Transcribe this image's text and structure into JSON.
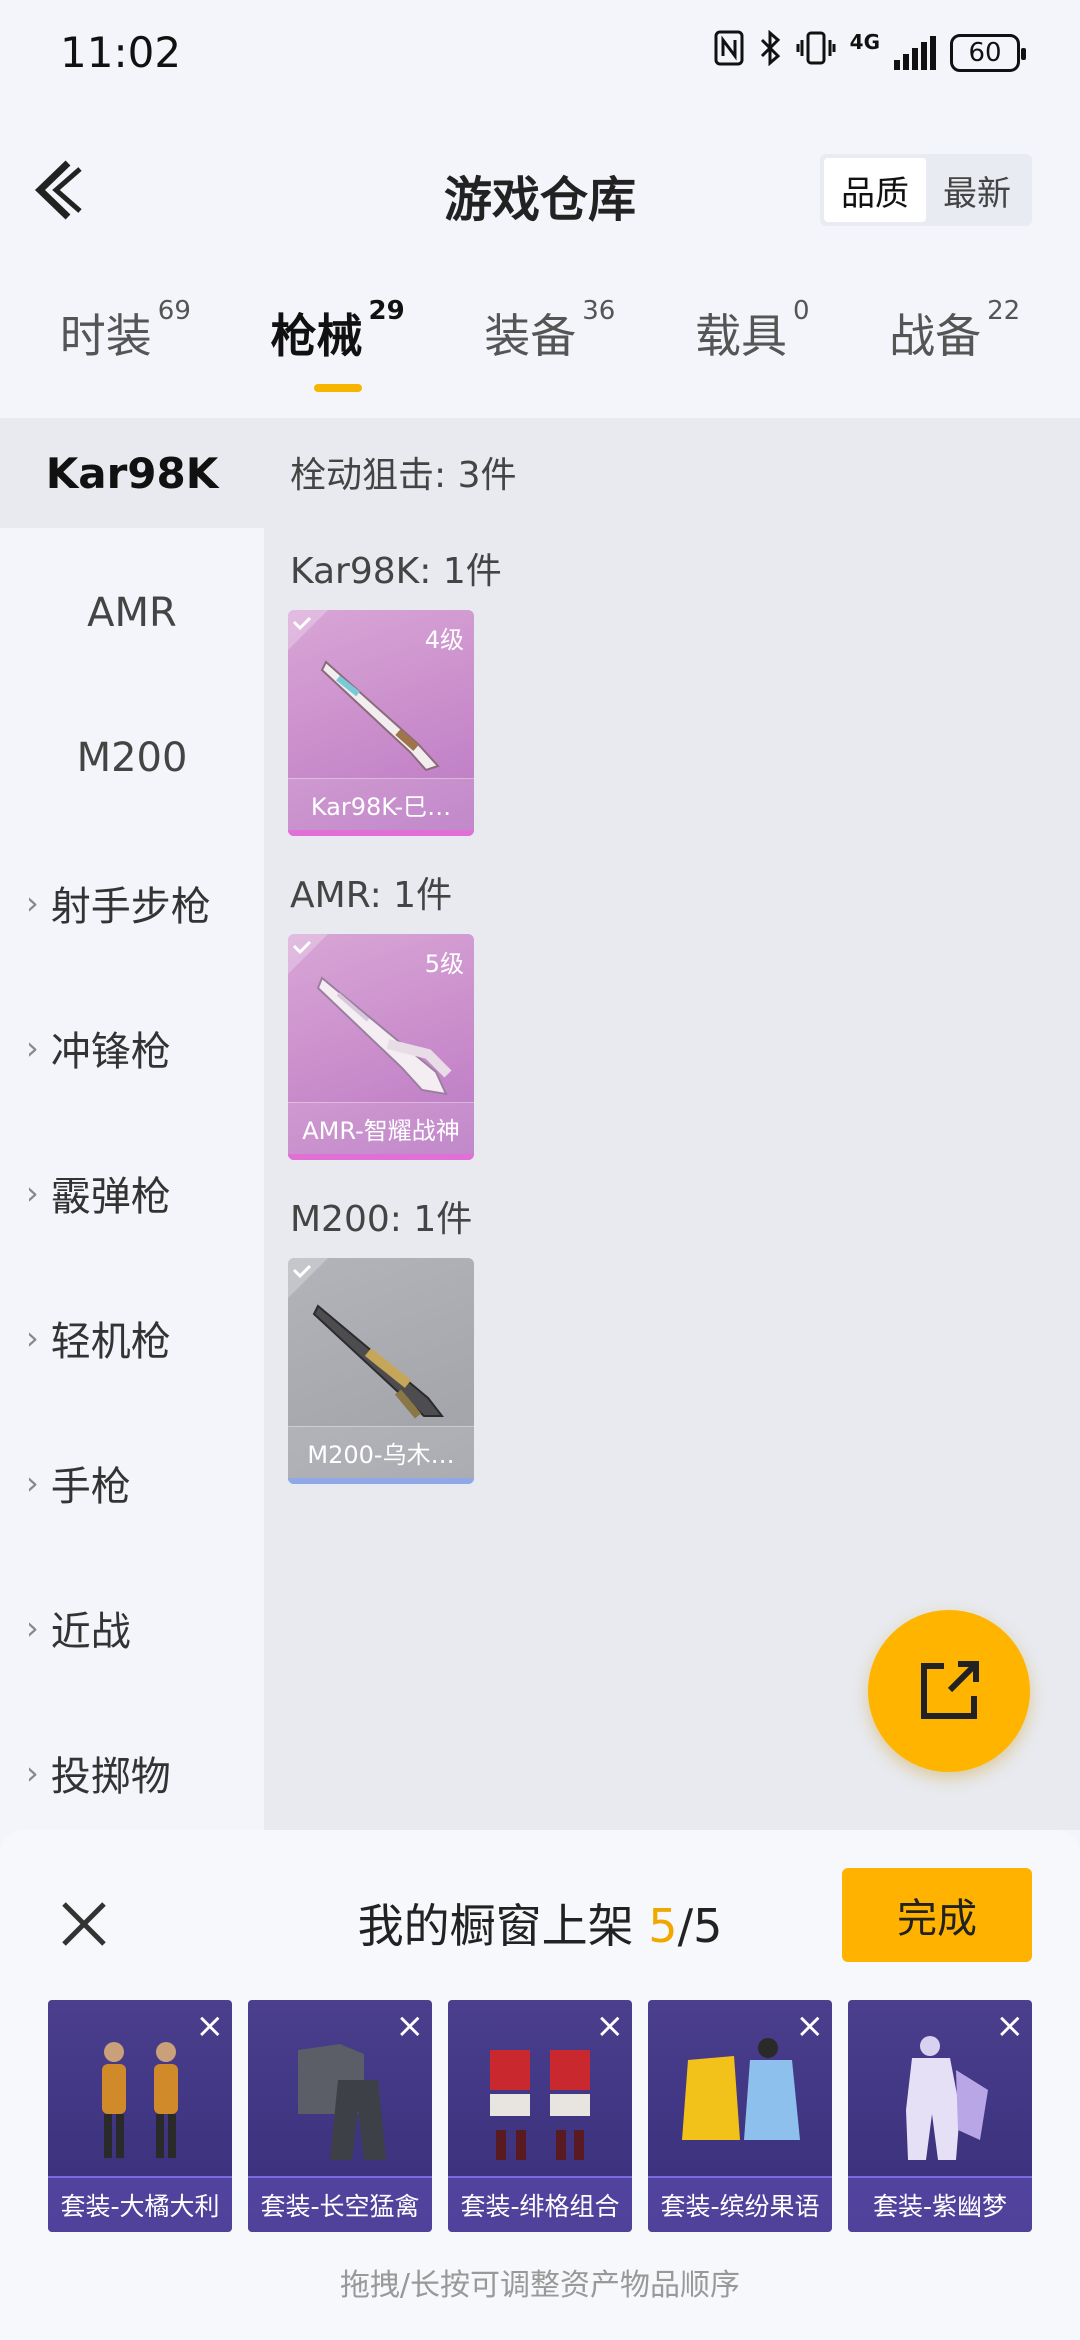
{
  "status": {
    "time": "11:02",
    "network": "4G",
    "battery": "60",
    "icons": [
      "nfc-icon",
      "bluetooth-icon",
      "vibrate-icon",
      "signal-icon",
      "battery-icon"
    ]
  },
  "header": {
    "title": "游戏仓库",
    "sort_options": [
      {
        "label": "品质",
        "active": true
      },
      {
        "label": "最新",
        "active": false
      }
    ]
  },
  "tabs": [
    {
      "label": "时装",
      "count": "69",
      "active": false
    },
    {
      "label": "枪械",
      "count": "29",
      "active": true
    },
    {
      "label": "装备",
      "count": "36",
      "active": false
    },
    {
      "label": "载具",
      "count": "0",
      "active": false
    },
    {
      "label": "战备",
      "count": "22",
      "active": false
    }
  ],
  "sidebar": {
    "items": [
      {
        "label": "Kar98K",
        "type": "active"
      },
      {
        "label": "AMR",
        "type": "sub"
      },
      {
        "label": "M200",
        "type": "sub"
      },
      {
        "label": "射手步枪",
        "type": "group"
      },
      {
        "label": "冲锋枪",
        "type": "group"
      },
      {
        "label": "霰弹枪",
        "type": "group"
      },
      {
        "label": "轻机枪",
        "type": "group"
      },
      {
        "label": "手枪",
        "type": "group"
      },
      {
        "label": "近战",
        "type": "group"
      },
      {
        "label": "投掷物",
        "type": "group"
      }
    ]
  },
  "main": {
    "category_summary": "栓动狙击: 3件",
    "sections": [
      {
        "header": "Kar98K: 1件",
        "item": {
          "name": "Kar98K-巳…",
          "level": "4级",
          "quality": "pink"
        }
      },
      {
        "header": "AMR: 1件",
        "item": {
          "name": "AMR-智耀战神",
          "level": "5级",
          "quality": "pink"
        }
      },
      {
        "header": "M200: 1件",
        "item": {
          "name": "M200-乌木…",
          "level": "",
          "quality": "gray"
        }
      }
    ]
  },
  "panel": {
    "title": "我的橱窗上架",
    "current": "5",
    "separator": "/",
    "total": "5",
    "done_label": "完成",
    "suits": [
      {
        "label": "套装-大橘大利"
      },
      {
        "label": "套装-长空猛禽"
      },
      {
        "label": "套装-绯格组合"
      },
      {
        "label": "套装-缤纷果语"
      },
      {
        "label": "套装-紫幽梦"
      }
    ],
    "hint": "拖拽/长按可调整资产物品顺序"
  },
  "colors": {
    "accent": "#ffb400",
    "pink_card": "#c98ccb",
    "gray_card": "#a3a5ab",
    "suit_bg": "#3e3480"
  }
}
